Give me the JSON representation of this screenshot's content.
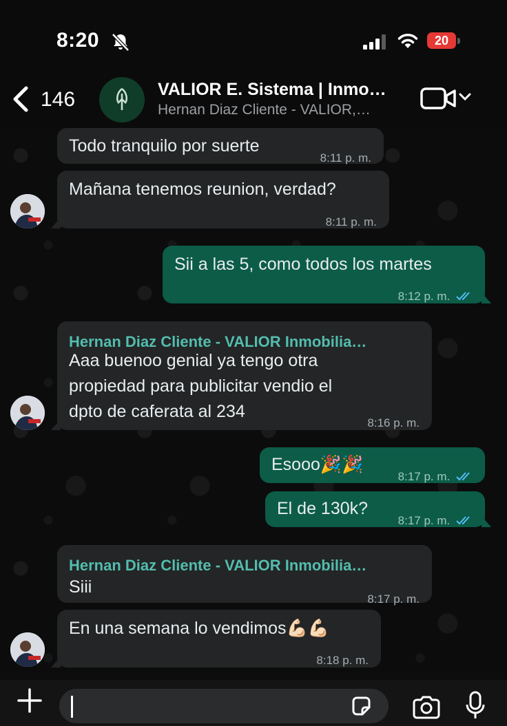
{
  "status_bar": {
    "time": "8:20",
    "battery": "20"
  },
  "header": {
    "back_count": "146",
    "title": "VALIOR E. Sistema | Inmo…",
    "subtitle": "Hernan Diaz Cliente - VALIOR,…"
  },
  "messages": [
    {
      "text": "Todo tranquilo por suerte",
      "time": "8:11 p. m."
    },
    {
      "text": "Mañana tenemos reunion, verdad?",
      "time": "8:11 p. m."
    },
    {
      "text": "Sii a las 5, como todos los martes",
      "time": "8:12 p. m."
    },
    {
      "sender": "Hernan Diaz Cliente - VALIOR Inmobilia…",
      "lines": [
        "Aaa buenoo genial ya tengo otra",
        "propiedad para publicitar vendio el",
        "dpto de caferata al 234"
      ],
      "time": "8:16 p. m."
    },
    {
      "text": "Esooo🎉🎉",
      "time": "8:17 p. m."
    },
    {
      "text": "El de 130k?",
      "time": "8:17 p. m."
    },
    {
      "sender": "Hernan Diaz Cliente - VALIOR Inmobilia…",
      "text": "Siii",
      "time": "8:17 p. m."
    },
    {
      "text": "En una semana lo vendimos💪🏻💪🏻",
      "time": "8:18 p. m."
    }
  ],
  "icons": [
    "bell-slash",
    "signal",
    "wifi",
    "back-chevron",
    "group-logo",
    "video-camera",
    "chevron-down",
    "read-ticks",
    "plus",
    "sticker",
    "camera",
    "microphone"
  ],
  "colors": {
    "outgoing_bubble": "#0c5c48",
    "incoming_bubble": "#232526",
    "sender_name": "#53bdae",
    "read_ticks": "#53bdf6",
    "battery": "#e53935"
  }
}
